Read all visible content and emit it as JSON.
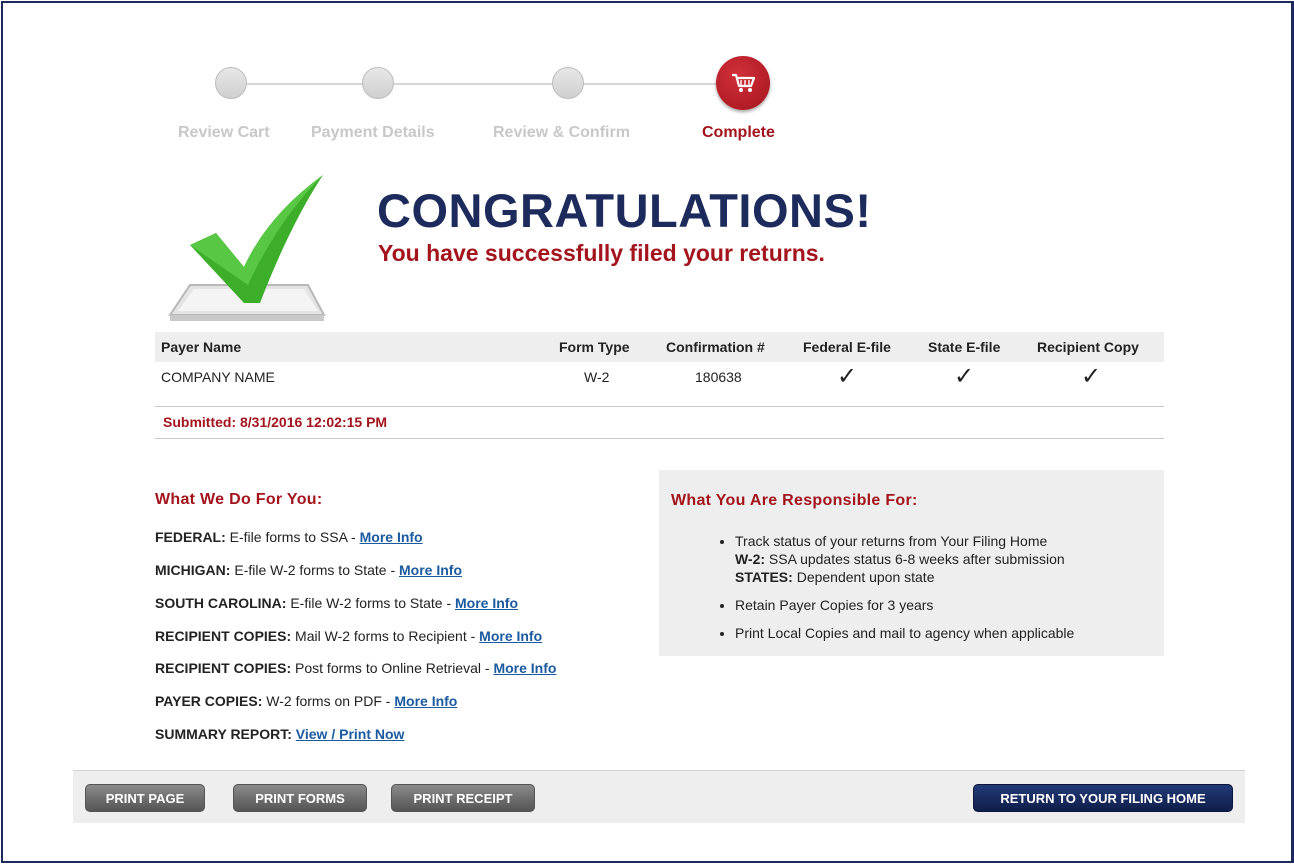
{
  "steps": [
    {
      "label": "Review Cart",
      "state": "done"
    },
    {
      "label": "Payment Details",
      "state": "done"
    },
    {
      "label": "Review & Confirm",
      "state": "done"
    },
    {
      "label": "Complete",
      "state": "active"
    }
  ],
  "headline": {
    "title": "CONGRATULATIONS!",
    "subtitle": "You have successfully filed your returns."
  },
  "table": {
    "headers": {
      "payer": "Payer Name",
      "form": "Form Type",
      "conf": "Confirmation #",
      "federal": "Federal E-file",
      "state": "State E-file",
      "recipient": "Recipient Copy"
    },
    "row": {
      "payer": "COMPANY NAME",
      "form": "W-2",
      "conf": "180638",
      "federal": "✓",
      "state": "✓",
      "recipient": "✓"
    },
    "submitted": "Submitted: 8/31/2016 12:02:15 PM"
  },
  "services": {
    "title": "What We Do For You:",
    "items": [
      {
        "prefix": "FEDERAL:",
        "text": " E-file forms to SSA - ",
        "link": "More Info"
      },
      {
        "prefix": "MICHIGAN:",
        "text": " E-file W-2 forms to State - ",
        "link": "More Info"
      },
      {
        "prefix": "SOUTH CAROLINA:",
        "text": " E-file W-2 forms to State - ",
        "link": "More Info"
      },
      {
        "prefix": "RECIPIENT COPIES:",
        "text": " Mail W-2 forms to Recipient - ",
        "link": "More Info"
      },
      {
        "prefix": "RECIPIENT COPIES:",
        "text": " Post forms to Online Retrieval - ",
        "link": "More Info"
      },
      {
        "prefix": "PAYER COPIES:",
        "text": " W-2 forms on PDF - ",
        "link": "More Info"
      },
      {
        "prefix": "SUMMARY REPORT:",
        "text": " ",
        "link": "View / Print Now"
      }
    ]
  },
  "responsibilities": {
    "title": "What You Are Responsible For:",
    "track": "Track status of your returns from Your Filing Home",
    "w2_label": "W-2:",
    "w2_text": " SSA updates status 6-8 weeks after submission",
    "states_label": "STATES:",
    "states_text": " Dependent upon state",
    "retain": "Retain Payer Copies for 3 years",
    "local": "Print Local Copies and mail to agency when applicable"
  },
  "buttons": {
    "print_page": "PRINT PAGE",
    "print_forms": "PRINT FORMS",
    "print_receipt": "PRINT RECEIPT",
    "return_home": "RETURN TO YOUR FILING HOME"
  },
  "colors": {
    "navy": "#1c2a5c",
    "red": "#a3141d",
    "green": "#3cae2a",
    "link": "#1a5aa0"
  },
  "icons": {
    "active_step": "shopping-cart-icon",
    "success": "checkmark-ballot-icon",
    "table_check": "check-icon"
  }
}
